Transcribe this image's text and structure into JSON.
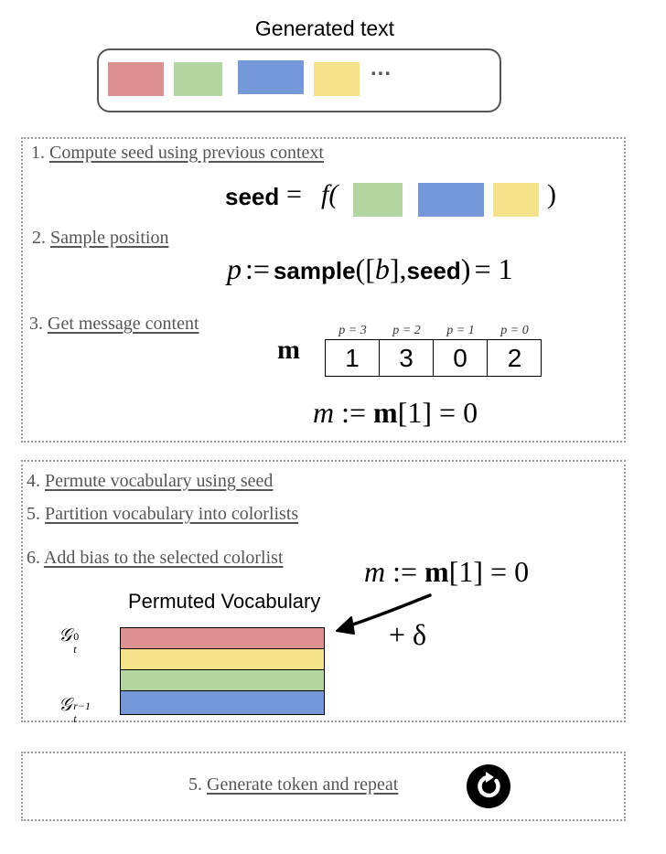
{
  "header": {
    "title": "Generated text",
    "ellipsis": "...",
    "colors": [
      "#dc9090",
      "#b3d5a1",
      "#7599d8",
      "#f5e38c"
    ]
  },
  "step1": {
    "number": "1.",
    "label": "Compute seed using previous context",
    "seed_word": "seed",
    "equals": "=",
    "func": "f(",
    "close": ")"
  },
  "step2": {
    "number": "2.",
    "label": "Sample position",
    "p": "p",
    "assign": ":=",
    "sample_word": "sample",
    "args_open": "([",
    "b": "b",
    "args_mid": "],",
    "seed_word": "seed",
    "args_close": ")",
    "result": "= 1"
  },
  "step3": {
    "number": "3.",
    "label": "Get message content",
    "vector_name": "m",
    "positions": [
      "p = 3",
      "p = 2",
      "p = 1",
      "p = 0"
    ],
    "values": [
      "1",
      "3",
      "0",
      "2"
    ],
    "result_m": "m",
    "result_assign": ":=",
    "result_bold": "m",
    "result_rest": "[1] = 0"
  },
  "step4": {
    "number": "4.",
    "label": "Permute vocabulary using seed"
  },
  "step5": {
    "number": "5.",
    "label": "Partition vocabulary into colorlists"
  },
  "step6": {
    "number": "6.",
    "label": "Add bias to the selected colorlist",
    "eq_m": "m",
    "eq_assign": ":=",
    "eq_bold": "m",
    "eq_rest": "[1] = 0",
    "bias": "+ δ",
    "vocab_title": "Permuted Vocabulary",
    "top_label_base": "𝒢",
    "top_label_sub": "t",
    "top_label_sup": "0",
    "bottom_label_base": "𝒢",
    "bottom_label_sub": "t",
    "bottom_label_sup": "r−1",
    "band_colors": [
      "#dc9090",
      "#f5e38c",
      "#b3d5a1",
      "#7599d8"
    ]
  },
  "step7": {
    "number": "5.",
    "label": "Generate token and repeat",
    "icon": "repeat-icon"
  }
}
